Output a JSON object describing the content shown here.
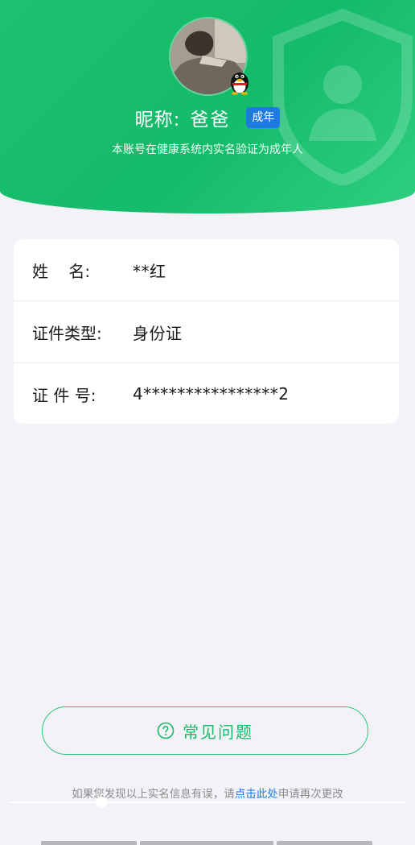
{
  "profile": {
    "nickname_label": "昵称:",
    "nickname_value": "爸爸",
    "age_badge": "成年",
    "verification_note": "本账号在健康系统内实名验证为成年人"
  },
  "info_card": {
    "rows": [
      {
        "label": "姓    名:",
        "value": "**红"
      },
      {
        "label": "证件类型:",
        "value": "身份证"
      },
      {
        "label": "证 件 号:",
        "value": "4****************2"
      }
    ]
  },
  "faq_button": {
    "label": "常见问题",
    "icon": "question-circle-icon"
  },
  "footer": {
    "text_before": "如果您发现以上实名信息有误，请",
    "link_text": "点击此处",
    "text_after": "申请再次更改"
  },
  "colors": {
    "header_green": "#1ec070",
    "accent_blue": "#1f7ae0",
    "faq_green": "#19b96b",
    "page_background": "#f2f2f7"
  },
  "video_scrubber": {
    "progress": 0.23
  }
}
